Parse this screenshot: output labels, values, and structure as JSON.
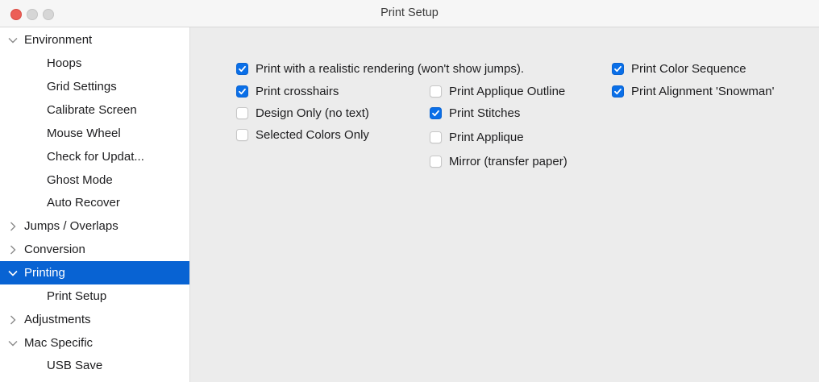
{
  "window": {
    "title": "Print Setup"
  },
  "sidebar": {
    "items": [
      {
        "label": "Environment",
        "level": "top",
        "state": "expanded"
      },
      {
        "label": "Hoops",
        "level": "child"
      },
      {
        "label": "Grid Settings",
        "level": "child"
      },
      {
        "label": "Calibrate Screen",
        "level": "child"
      },
      {
        "label": "Mouse Wheel",
        "level": "child"
      },
      {
        "label": "Check for Updat...",
        "level": "child"
      },
      {
        "label": "Ghost Mode",
        "level": "child"
      },
      {
        "label": "Auto Recover",
        "level": "child"
      },
      {
        "label": "Jumps / Overlaps",
        "level": "top",
        "state": "collapsed"
      },
      {
        "label": "Conversion",
        "level": "top",
        "state": "collapsed"
      },
      {
        "label": "Printing",
        "level": "top",
        "state": "expanded",
        "selected": true
      },
      {
        "label": "Print Setup",
        "level": "child"
      },
      {
        "label": "Adjustments",
        "level": "top",
        "state": "collapsed"
      },
      {
        "label": "Mac Specific",
        "level": "top",
        "state": "expanded"
      },
      {
        "label": "USB Save",
        "level": "child"
      }
    ]
  },
  "options": {
    "realistic_rendering": {
      "label": "Print with a realistic rendering (won't show jumps).",
      "checked": true
    },
    "crosshairs": {
      "label": "Print crosshairs",
      "checked": true
    },
    "design_only": {
      "label": "Design Only (no text)",
      "checked": false
    },
    "selected_colors_only": {
      "label": "Selected Colors Only",
      "checked": false
    },
    "applique_outline": {
      "label": "Print Applique Outline",
      "checked": false
    },
    "print_stitches": {
      "label": "Print Stitches",
      "checked": true
    },
    "print_applique": {
      "label": "Print Applique",
      "checked": false
    },
    "mirror": {
      "label": "Mirror (transfer paper)",
      "checked": false
    },
    "color_sequence": {
      "label": "Print Color Sequence",
      "checked": true
    },
    "alignment_snowman": {
      "label": "Print Alignment 'Snowman'",
      "checked": true
    }
  },
  "colors": {
    "accent": "#0a6fe8",
    "selection": "#0863d3",
    "close_button": "#ec5f57"
  }
}
